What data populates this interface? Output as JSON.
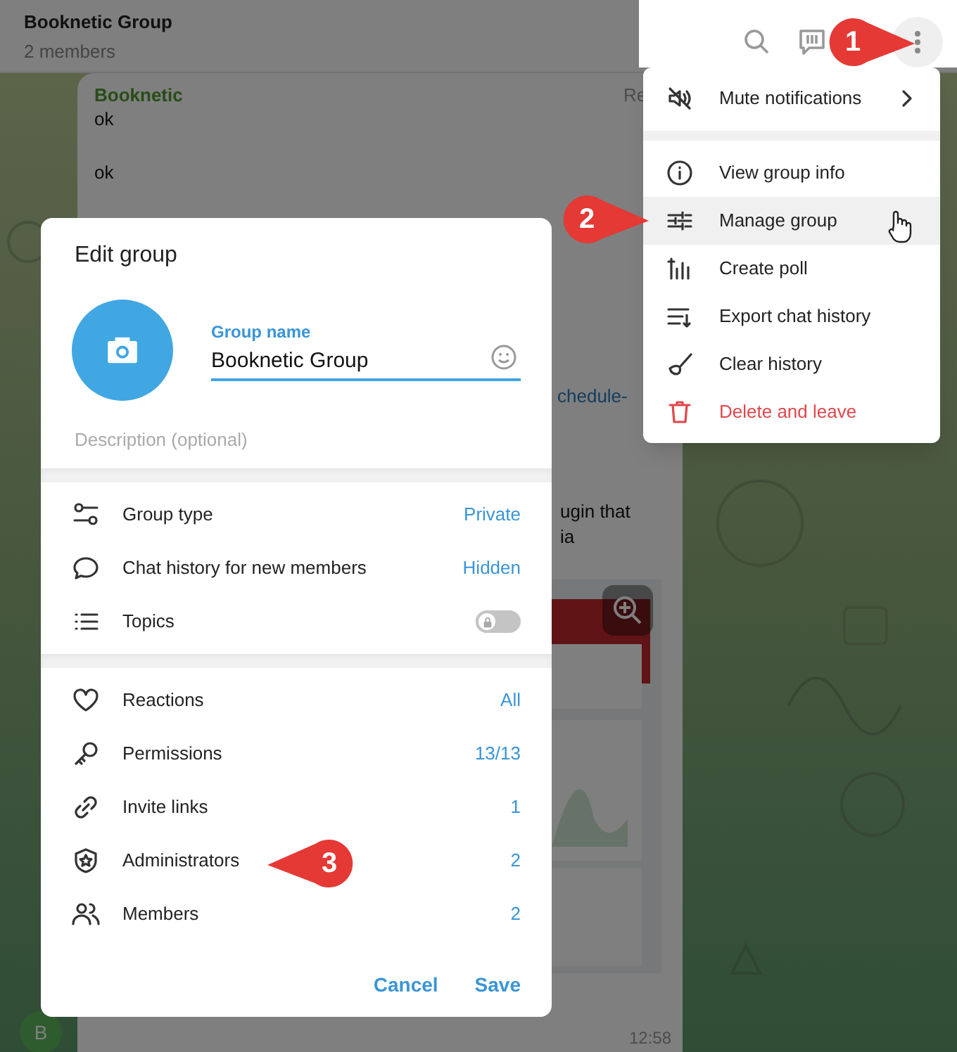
{
  "chat_header": {
    "title": "Booknetic Group",
    "subtitle": "2 members"
  },
  "message": {
    "sender": "Booknetic",
    "lines": [
      "ok",
      "ok"
    ],
    "reply_label": "Re",
    "link_fragment": "chedule-",
    "text_fragment": [
      "ugin that",
      "ia"
    ],
    "time": "12:58",
    "avatar_letter": "B",
    "attachment": {
      "kind": "picture"
    }
  },
  "menu": {
    "items": [
      {
        "label": "Mute notifications",
        "kind": "submenu",
        "highlighted": false
      },
      {
        "label": "View group info",
        "kind": "item",
        "highlighted": false
      },
      {
        "label": "Manage group",
        "kind": "item",
        "highlighted": true
      },
      {
        "label": "Create poll",
        "kind": "item",
        "highlighted": false
      },
      {
        "label": "Export chat history",
        "kind": "item",
        "highlighted": false
      },
      {
        "label": "Clear history",
        "kind": "item",
        "highlighted": false
      },
      {
        "label": "Delete and leave",
        "kind": "danger",
        "highlighted": false
      }
    ]
  },
  "dialog": {
    "title": "Edit group",
    "name_label": "Group name",
    "name_value": "Booknetic Group",
    "description_placeholder": "Description (optional)",
    "sections": [
      [
        {
          "label": "Group type",
          "kind": "value",
          "value": "Private"
        },
        {
          "label": "Chat history for new members",
          "kind": "value",
          "value": "Hidden"
        },
        {
          "label": "Topics",
          "kind": "toggle",
          "on": false,
          "locked": true
        }
      ],
      [
        {
          "label": "Reactions",
          "kind": "value",
          "value": "All"
        },
        {
          "label": "Permissions",
          "kind": "value",
          "value": "13/13"
        },
        {
          "label": "Invite links",
          "kind": "value",
          "value": "1"
        },
        {
          "label": "Administrators",
          "kind": "value",
          "value": "2"
        },
        {
          "label": "Members",
          "kind": "value",
          "value": "2"
        }
      ]
    ],
    "buttons": [
      "Cancel",
      "Save"
    ]
  },
  "callouts": [
    {
      "number": "1"
    },
    {
      "number": "2"
    },
    {
      "number": "3"
    }
  ]
}
